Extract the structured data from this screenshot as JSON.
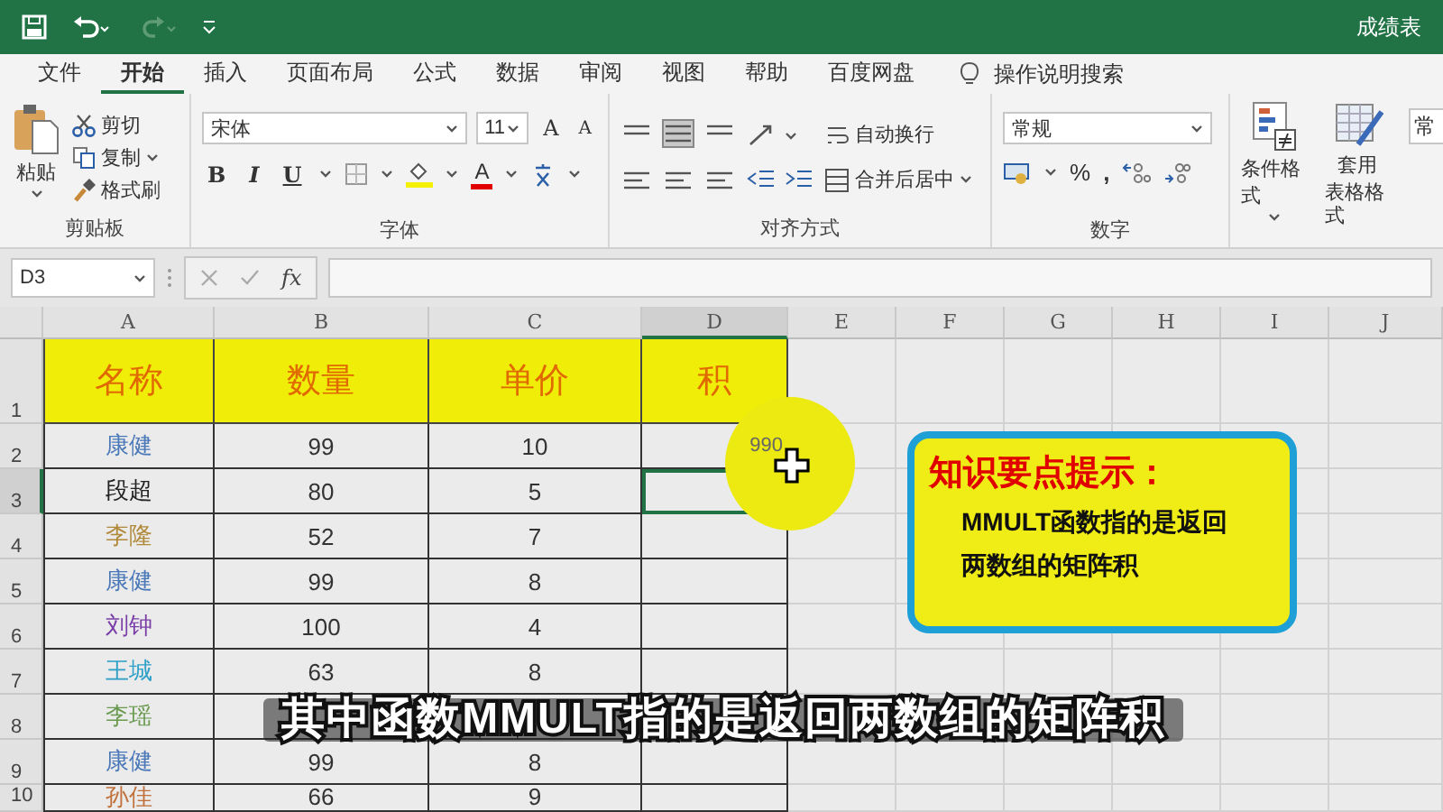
{
  "title_bar": {
    "title": "成绩表"
  },
  "tabs": [
    {
      "label": "文件",
      "selected": false
    },
    {
      "label": "开始",
      "selected": true
    },
    {
      "label": "插入",
      "selected": false
    },
    {
      "label": "页面布局",
      "selected": false
    },
    {
      "label": "公式",
      "selected": false
    },
    {
      "label": "数据",
      "selected": false
    },
    {
      "label": "审阅",
      "selected": false
    },
    {
      "label": "视图",
      "selected": false
    },
    {
      "label": "帮助",
      "selected": false
    },
    {
      "label": "百度网盘",
      "selected": false
    }
  ],
  "search": {
    "label": "操作说明搜索"
  },
  "ribbon": {
    "clipboard": {
      "paste": "粘贴",
      "cut": "剪切",
      "copy": "复制",
      "format_painter": "格式刷",
      "label": "剪贴板"
    },
    "font": {
      "font_name": "宋体",
      "font_size": "11",
      "grow": "A",
      "shrink": "A",
      "bold": "B",
      "italic": "I",
      "underline": "U",
      "font_color": "A",
      "label": "字体"
    },
    "alignment": {
      "wrap_text": "自动换行",
      "merge_center": "合并后居中",
      "label": "对齐方式"
    },
    "number": {
      "format": "常规",
      "percent": "%",
      "comma": ",",
      "label": "数字"
    },
    "styles": {
      "conditional_formatting": "条件格式",
      "format_as_table": [
        "套用",
        "表格格式"
      ],
      "cell_styles": "常"
    }
  },
  "formula_bar": {
    "name_box": "D3",
    "fx": "fx"
  },
  "sheet": {
    "columns": [
      {
        "label": "A",
        "selected": false
      },
      {
        "label": "B",
        "selected": false
      },
      {
        "label": "C",
        "selected": false
      },
      {
        "label": "D",
        "selected": true
      },
      {
        "label": "E",
        "selected": false
      },
      {
        "label": "F",
        "selected": false
      },
      {
        "label": "G",
        "selected": false
      },
      {
        "label": "H",
        "selected": false
      },
      {
        "label": "I",
        "selected": false
      },
      {
        "label": "J",
        "selected": false
      }
    ],
    "header_row": {
      "number": "1",
      "cells": [
        "名称",
        "数量",
        "单价",
        "积"
      ]
    },
    "rows": [
      {
        "number": "2",
        "name": "康健",
        "color": "#4a78b8",
        "quantity": "99",
        "price": "10",
        "product": "990",
        "selected": false
      },
      {
        "number": "3",
        "name": "段超",
        "color": "#222222",
        "quantity": "80",
        "price": "5",
        "selected": true
      },
      {
        "number": "4",
        "name": "李隆",
        "color": "#b08a3a",
        "quantity": "52",
        "price": "7",
        "selected": false
      },
      {
        "number": "5",
        "name": "康健",
        "color": "#4a78b8",
        "quantity": "99",
        "price": "8",
        "selected": false
      },
      {
        "number": "6",
        "name": "刘钟",
        "color": "#7a3fa8",
        "quantity": "100",
        "price": "4",
        "selected": false
      },
      {
        "number": "7",
        "name": "王城",
        "color": "#2ea0c8",
        "quantity": "63",
        "price": "8",
        "selected": false
      },
      {
        "number": "8",
        "name": "李瑶",
        "color": "#6a9a50",
        "selected": false
      },
      {
        "number": "9",
        "name": "康健",
        "color": "#4a78b8",
        "quantity": "99",
        "price": "8",
        "selected": false
      },
      {
        "number": "10",
        "name": "孙佳",
        "color": "#c0703a",
        "quantity": "66",
        "price": "9",
        "selected": false
      }
    ]
  },
  "callout": {
    "title": "知识要点提示：",
    "lines": [
      "MMULT函数指的是返回",
      "两数组的矩阵积"
    ]
  },
  "caption": "其中函数MMULT指的是返回两数组的矩阵积"
}
